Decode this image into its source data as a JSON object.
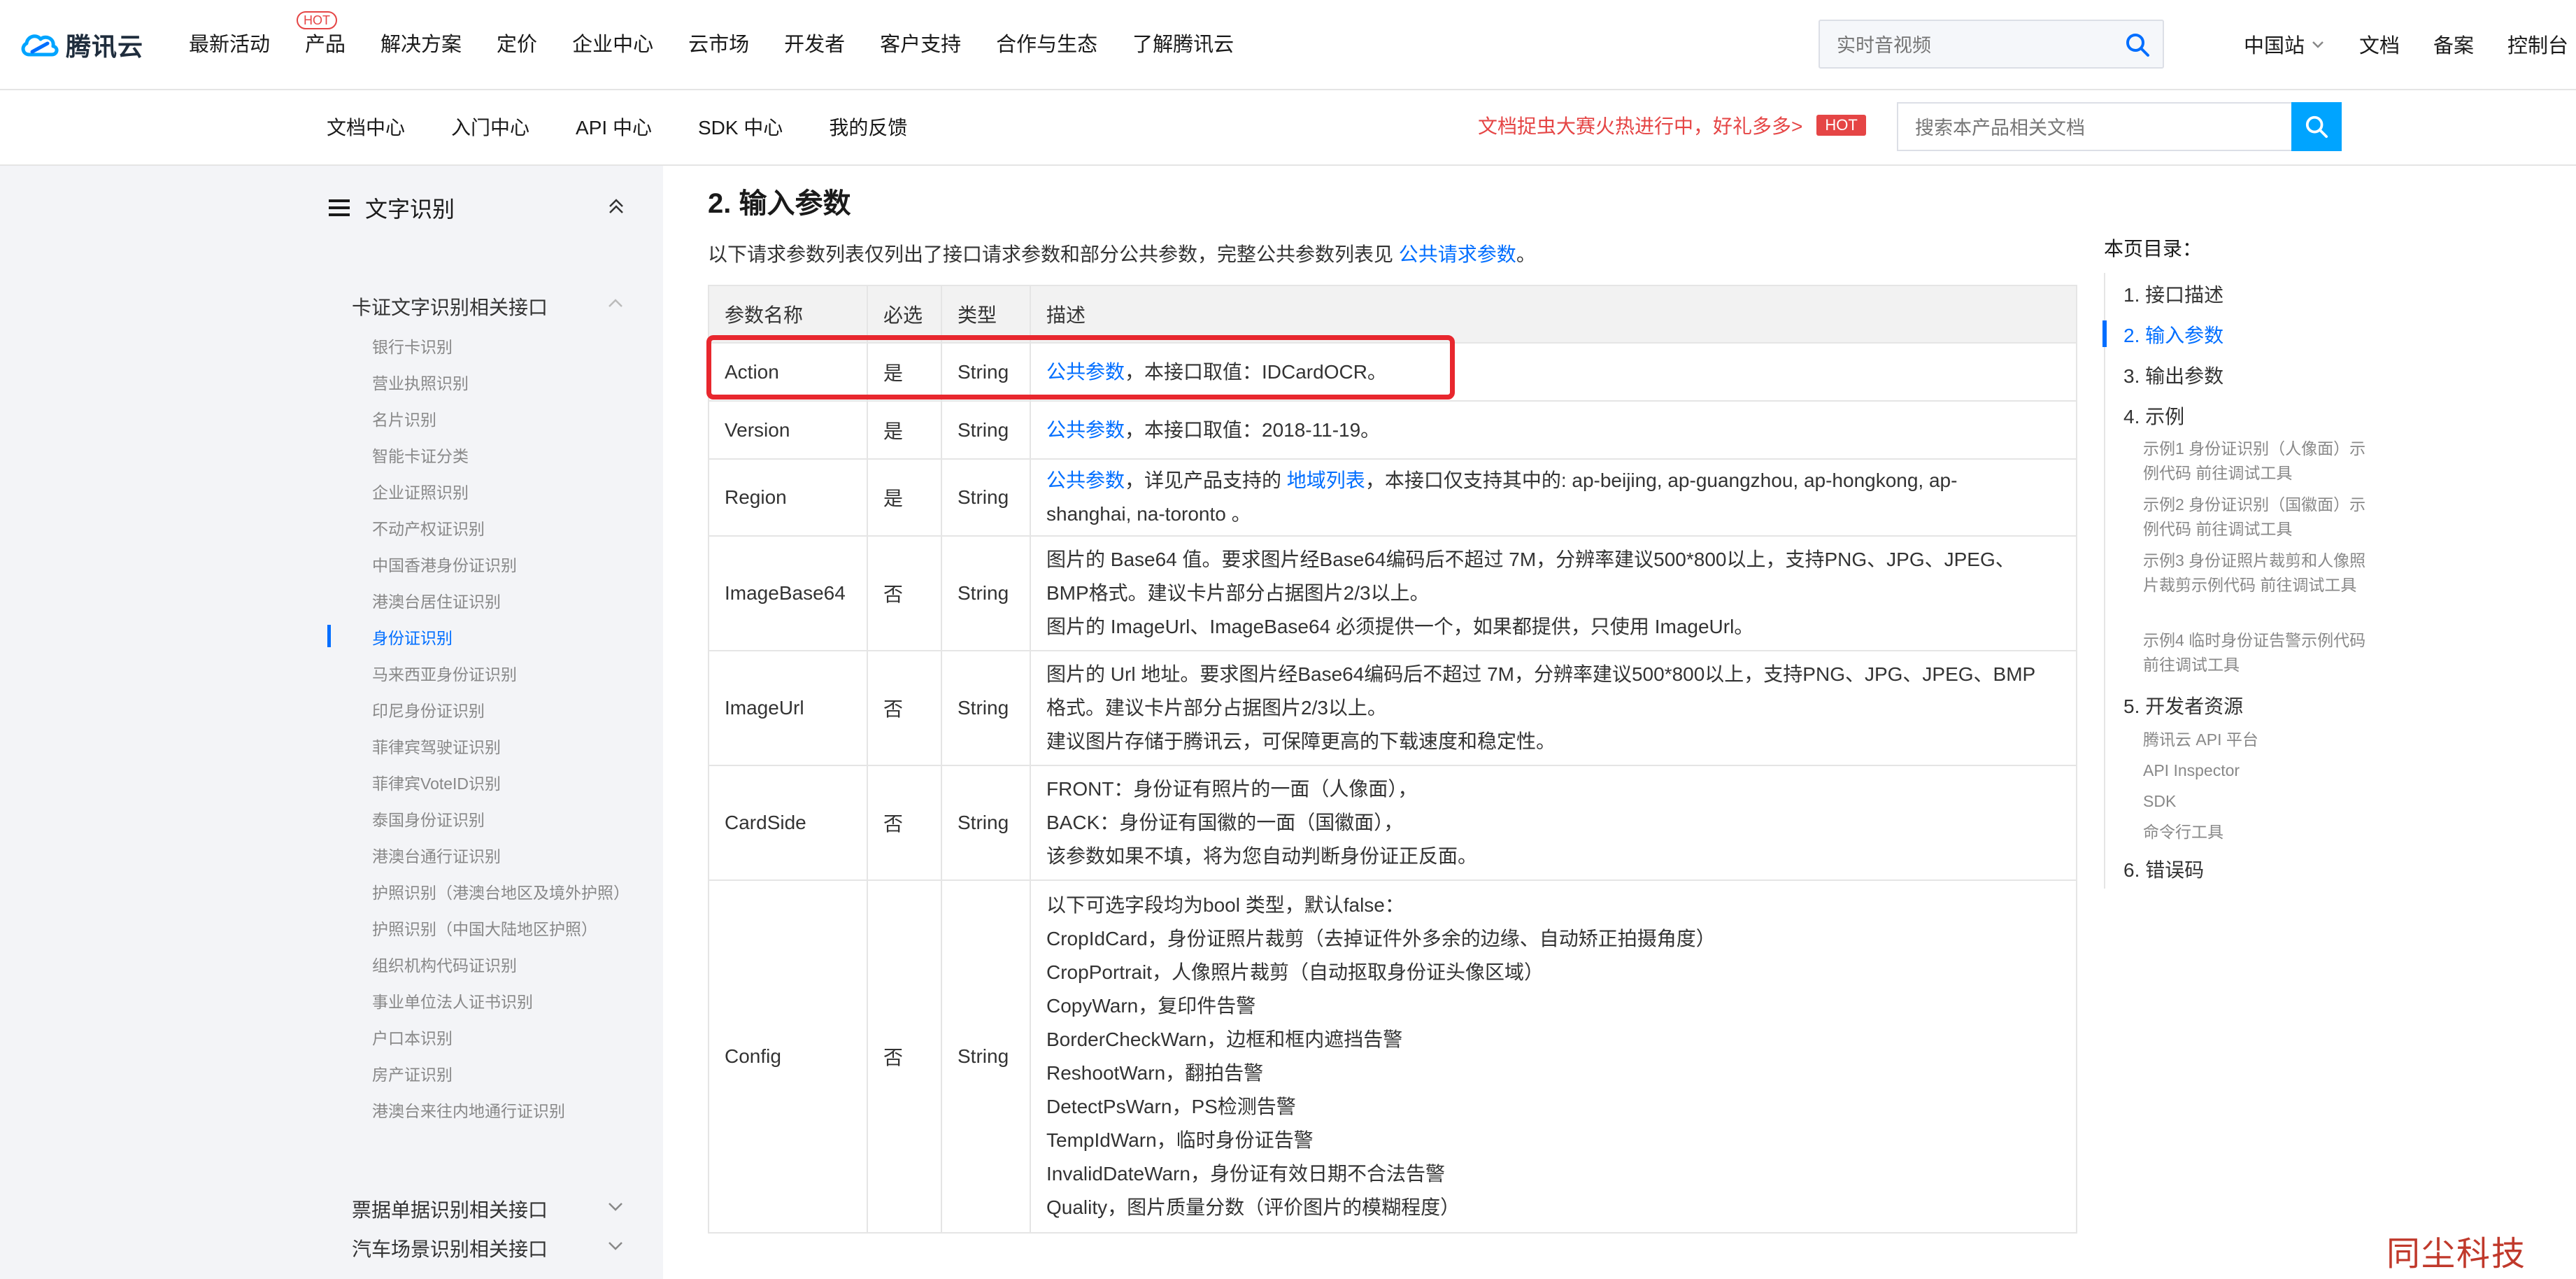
{
  "header": {
    "logo_text": "腾讯云",
    "nav": [
      "最新活动",
      "产品",
      "解决方案",
      "定价",
      "企业中心",
      "云市场",
      "开发者",
      "客户支持",
      "合作与生态",
      "了解腾讯云"
    ],
    "hot_label": "HOT",
    "search_placeholder": "实时音视频",
    "region": "中国站",
    "right_links": [
      "文档",
      "备案",
      "控制台"
    ]
  },
  "subnav": {
    "items": [
      "文档中心",
      "入门中心",
      "API 中心",
      "SDK 中心",
      "我的反馈"
    ],
    "promo": "文档捉虫大赛火热进行中，好礼多多>",
    "promo_badge": "HOT",
    "search_placeholder": "搜索本产品相关文档"
  },
  "sidebar": {
    "title": "文字识别",
    "group_open": "卡证文字识别相关接口",
    "items": [
      "银行卡识别",
      "营业执照识别",
      "名片识别",
      "智能卡证分类",
      "企业证照识别",
      "不动产权证识别",
      "中国香港身份证识别",
      "港澳台居住证识别",
      "身份证识别",
      "马来西亚身份证识别",
      "印尼身份证识别",
      "菲律宾驾驶证识别",
      "菲律宾VoteID识别",
      "泰国身份证识别",
      "港澳台通行证识别",
      "护照识别（港澳台地区及境外护照）",
      "护照识别（中国大陆地区护照）",
      "组织机构代码证识别",
      "事业单位法人证书识别",
      "户口本识别",
      "房产证识别",
      "港澳台来往内地通行证识别"
    ],
    "active_index": 8,
    "groups_closed": [
      "票据单据识别相关接口",
      "汽车场景识别相关接口"
    ]
  },
  "main": {
    "title": "2. 输入参数",
    "intro_before": "以下请求参数列表仅列出了接口请求参数和部分公共参数，完整公共参数列表见 ",
    "intro_link": "公共请求参数",
    "intro_after": "。",
    "table": {
      "headers": [
        "参数名称",
        "必选",
        "类型",
        "描述"
      ],
      "rows": [
        {
          "name": "Action",
          "required": "是",
          "type": "String",
          "link": "公共参数",
          "lines": [
            "，本接口取值：IDCardOCR。"
          ]
        },
        {
          "name": "Version",
          "required": "是",
          "type": "String",
          "link": "公共参数",
          "lines": [
            "，本接口取值：2018-11-19。"
          ]
        },
        {
          "name": "Region",
          "required": "是",
          "type": "String",
          "link": "公共参数",
          "link2_before": "，详见产品支持的 ",
          "link2": "地域列表",
          "lines": [
            "，本接口仅支持其中的: ap-beijing, ap-guangzhou, ap-hongkong, ap-",
            "shanghai, na-toronto 。"
          ]
        },
        {
          "name": "ImageBase64",
          "required": "否",
          "type": "String",
          "lines": [
            "图片的 Base64 值。要求图片经Base64编码后不超过 7M，分辨率建议500*800以上，支持PNG、JPG、JPEG、",
            "BMP格式。建议卡片部分占据图片2/3以上。",
            "图片的 ImageUrl、ImageBase64 必须提供一个，如果都提供，只使用 ImageUrl。"
          ]
        },
        {
          "name": "ImageUrl",
          "required": "否",
          "type": "String",
          "lines": [
            "图片的 Url 地址。要求图片经Base64编码后不超过 7M，分辨率建议500*800以上，支持PNG、JPG、JPEG、BMP",
            "格式。建议卡片部分占据图片2/3以上。",
            "建议图片存储于腾讯云，可保障更高的下载速度和稳定性。"
          ]
        },
        {
          "name": "CardSide",
          "required": "否",
          "type": "String",
          "lines": [
            "FRONT：身份证有照片的一面（人像面），",
            "BACK：身份证有国徽的一面（国徽面），",
            "该参数如果不填，将为您自动判断身份证正反面。"
          ]
        },
        {
          "name": "Config",
          "required": "否",
          "type": "String",
          "lines": [
            "以下可选字段均为bool 类型，默认false：",
            "CropIdCard，身份证照片裁剪（去掉证件外多余的边缘、自动矫正拍摄角度）",
            "CropPortrait，人像照片裁剪（自动抠取身份证头像区域）",
            "CopyWarn，复印件告警",
            "BorderCheckWarn，边框和框内遮挡告警",
            "ReshootWarn，翻拍告警",
            "DetectPsWarn，PS检测告警",
            "TempIdWarn，临时身份证告警",
            "InvalidDateWarn，身份证有效日期不合法告警",
            "Quality，图片质量分数（评价图片的模糊程度）"
          ]
        }
      ]
    }
  },
  "toc": {
    "title": "本页目录：",
    "items": [
      "1. 接口描述",
      "2. 输入参数",
      "3. 输出参数",
      "4. 示例",
      "5. 开发者资源",
      "6. 错误码"
    ],
    "active_index": 1,
    "example_subs": [
      "示例1 身份证识别（人像面）示例代码 前往调试工具",
      "示例2 身份证识别（国徽面）示例代码 前往调试工具",
      "示例3 身份证照片裁剪和人像照片裁剪示例代码 前往调试工具",
      "示例4 临时身份证告警示例代码 前往调试工具"
    ],
    "dev_subs": [
      "腾讯云 API 平台",
      "API Inspector",
      "SDK",
      "命令行工具"
    ]
  },
  "watermark": "同尘科技",
  "colors": {
    "accent": "#006eff",
    "hot": "#e54545",
    "highlight": "#e8272e",
    "search_btn": "#00a4ff"
  }
}
